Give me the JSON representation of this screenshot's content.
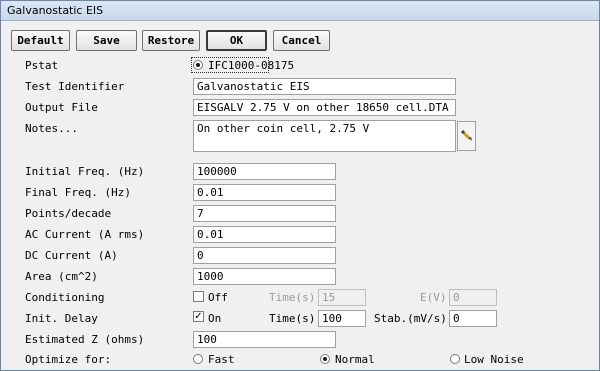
{
  "window": {
    "title": "Galvanostatic EIS"
  },
  "buttons": {
    "default": "Default",
    "save": "Save",
    "restore": "Restore",
    "ok": "OK",
    "cancel": "Cancel"
  },
  "fields": {
    "pstat": {
      "label": "Pstat",
      "option": "IFC1000-08175"
    },
    "test_identifier": {
      "label": "Test Identifier",
      "value": "Galvanostatic EIS"
    },
    "output_file": {
      "label": "Output File",
      "value": "EISGALV 2.75 V on other 18650 cell.DTA"
    },
    "notes": {
      "label": "Notes...",
      "value": "On other coin cell, 2.75 V"
    },
    "initial_freq": {
      "label": "Initial Freq. (Hz)",
      "value": "100000"
    },
    "final_freq": {
      "label": "Final Freq. (Hz)",
      "value": "0.01"
    },
    "points_decade": {
      "label": "Points/decade",
      "value": "7"
    },
    "ac_current": {
      "label": "AC Current (A rms)",
      "value": "0.01"
    },
    "dc_current": {
      "label": "DC Current (A)",
      "value": "0"
    },
    "area": {
      "label": "Area (cm^2)",
      "value": "1000"
    },
    "conditioning": {
      "label": "Conditioning",
      "checkbox_label": "Off",
      "time_label": "Time(s)",
      "time_value": "15",
      "ev_label": "E(V)",
      "ev_value": "0"
    },
    "init_delay": {
      "label": "Init. Delay",
      "checkbox_label": "On",
      "time_label": "Time(s)",
      "time_value": "100",
      "stab_label": "Stab.(mV/s)",
      "stab_value": "0"
    },
    "estimated_z": {
      "label": "Estimated Z (ohms)",
      "value": "100"
    },
    "optimize_for": {
      "label": "Optimize for:",
      "options": [
        "Fast",
        "Normal",
        "Low Noise"
      ],
      "selected": "Normal"
    }
  }
}
